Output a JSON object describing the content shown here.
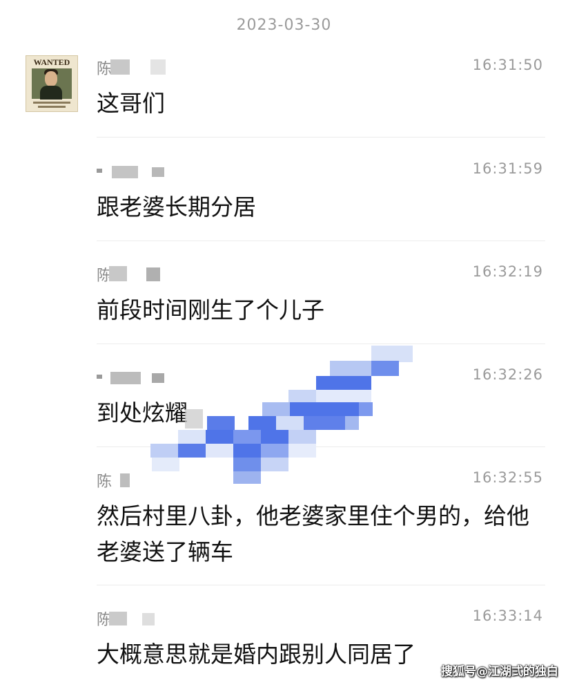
{
  "chat": {
    "date": "2023-03-30",
    "avatar_text": "WANTED",
    "messages": [
      {
        "sender": "陈",
        "time": "16:31:50",
        "text": "这哥们"
      },
      {
        "sender": "",
        "time": "16:31:59",
        "text": "跟老婆长期分居"
      },
      {
        "sender": "陈",
        "time": "16:32:19",
        "text": "前段时间刚生了个儿子"
      },
      {
        "sender": "",
        "time": "16:32:26",
        "text": "到处炫耀"
      },
      {
        "sender": "陈",
        "time": "16:32:55",
        "text": "然后村里八卦，他老婆家里住个男的，给他老婆送了辆车"
      },
      {
        "sender": "陈",
        "time": "16:33:14",
        "text": "大概意思就是婚内跟别人同居了"
      }
    ]
  },
  "watermark": "搜狐号@江湖弍的独白",
  "colors": {
    "mosaic_blue": "#4f74e8",
    "mosaic_light_blue": "#b7c8f3",
    "text": "#111111",
    "meta": "#9a9a9a"
  }
}
